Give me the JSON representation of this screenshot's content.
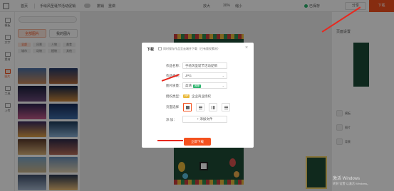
{
  "topbar": {
    "home_label": "首页",
    "doc_title": "手绘风圣诞节活动促销",
    "tools": [
      "撤销",
      "重做",
      "放大",
      "30%",
      "缩小"
    ],
    "saved_label": "已保存",
    "share_label": "分享",
    "download_label": "下载"
  },
  "rail": {
    "items": [
      {
        "label": "模板"
      },
      {
        "label": "文字"
      },
      {
        "label": "素材"
      },
      {
        "label": "图片"
      },
      {
        "label": "工具"
      },
      {
        "label": "上传"
      }
    ]
  },
  "panel": {
    "tabs": [
      "全部图片",
      "我的图片"
    ],
    "chips": [
      "全部",
      "风景",
      "人物",
      "美食",
      "城市",
      "动物",
      "植物",
      "其他"
    ]
  },
  "modal": {
    "title": "下载",
    "option_label": "同时保存作品至云端并下载（已有版权素材）",
    "close": "×",
    "fields": {
      "name_label": "作品名称：",
      "name_value": "手绘风圣诞节活动促销",
      "format_label": "作品格式：",
      "format_value": "JPG",
      "quality_label": "图片质量：",
      "quality_value": "高清",
      "quality_badge": "推荐",
      "license_label": "授权类型：",
      "license_badge": "VIP",
      "license_value": "企业商业授权",
      "pages_label": "页面选择",
      "add_label": "添 加：",
      "add_file": "+ 添加文件"
    },
    "download_button": "立即下载"
  },
  "right_panel": {
    "title": "页面设置",
    "items": [
      "模板",
      "图片",
      "背景"
    ]
  },
  "watermark": {
    "line1": "激活 Windows",
    "line2": "转到\"设置\"以激活 Windows。"
  }
}
